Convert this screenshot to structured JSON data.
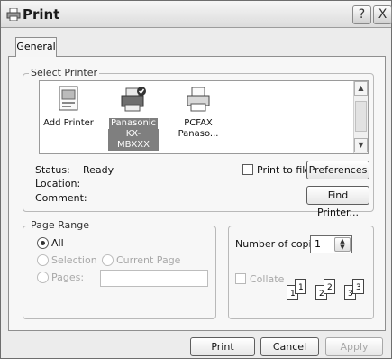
{
  "window": {
    "title": "Print",
    "help_button": "?",
    "close_button": "X",
    "icon": "printer-icon"
  },
  "tabs": [
    {
      "label": "General",
      "active": true
    }
  ],
  "select_printer": {
    "group_title": "Select Printer",
    "printers": [
      {
        "label": "Add Printer",
        "icon": "add-printer-icon",
        "selected": false
      },
      {
        "label_line1": "Panasonic",
        "label_line2": "KX-MBXXX",
        "icon": "printer-default-icon",
        "selected": true
      },
      {
        "label_line1": "PCFAX",
        "label_line2": "Panaso...",
        "icon": "fax-printer-icon",
        "selected": false
      }
    ],
    "status_label": "Status:",
    "status_value": "Ready",
    "location_label": "Location:",
    "comment_label": "Comment:",
    "print_to_file_label": "Print to file",
    "print_to_file_checked": false,
    "preferences_button": "Preferences",
    "find_printer_button": "Find Printer..."
  },
  "page_range": {
    "group_title": "Page Range",
    "options": {
      "all": "All",
      "selection": "Selection",
      "current_page": "Current Page",
      "pages": "Pages:"
    },
    "selected": "all",
    "pages_value": ""
  },
  "copies": {
    "number_label": "Number of copies:",
    "number_value": "1",
    "collate_label": "Collate",
    "collate_checked": false,
    "collate_pages": [
      "1",
      "1",
      "2",
      "2",
      "3",
      "3"
    ]
  },
  "buttons": {
    "print": "Print",
    "cancel": "Cancel",
    "apply": "Apply"
  },
  "colors": {
    "window_bg": "#ececec",
    "panel_bg": "#f7f7f7",
    "selected_item_bg": "#7f7f7f"
  }
}
